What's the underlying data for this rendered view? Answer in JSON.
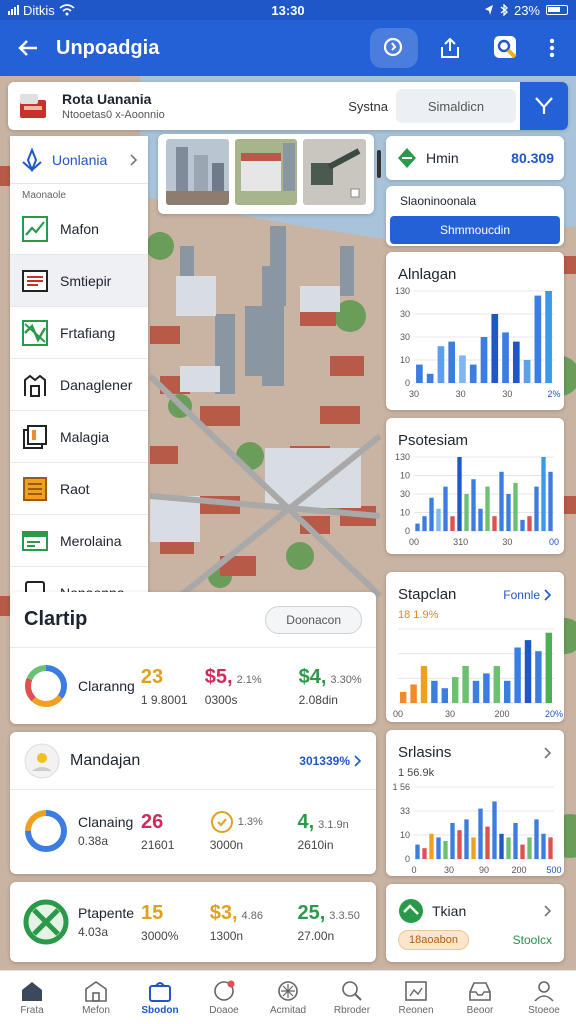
{
  "status_bar": {
    "carrier": "Ditkis",
    "time": "13:30",
    "battery": "23%"
  },
  "app_bar": {
    "title": "Unpoadgia"
  },
  "search": {
    "title": "Rota Uanania",
    "subtitle": "Ntooetas0 x-Aoonnio",
    "label": "Systna",
    "placeholder": "Simaldicn"
  },
  "sidebar": {
    "header": "Uonlania",
    "section": "Maonaole",
    "items": [
      {
        "label": "Mafon",
        "icon": "trend-chart-icon"
      },
      {
        "label": "Smtiepir",
        "icon": "list-document-icon"
      },
      {
        "label": "Frtafiang",
        "icon": "spark-chart-icon"
      },
      {
        "label": "Danaglener",
        "icon": "building-icon"
      },
      {
        "label": "Malagia",
        "icon": "bar-document-icon"
      },
      {
        "label": "Raot",
        "icon": "grid-document-icon"
      },
      {
        "label": "Merolaina",
        "icon": "card-icon"
      },
      {
        "label": "Nonaonna",
        "icon": "phone-icon"
      }
    ]
  },
  "right_panel": {
    "top": {
      "label": "Hmin",
      "value": "80.309"
    },
    "action": {
      "title": "Slaoninoonala",
      "button": "Shmmoucdin"
    },
    "chart1": {
      "title": "Alnlagan"
    },
    "chart2": {
      "title": "Psotesiam"
    },
    "chart3": {
      "title": "Stapclan",
      "link": "Fonnle",
      "subtitle": "18 1.9%"
    },
    "chart4": {
      "title": "Srlasins",
      "subtitle": "1 56.9k"
    },
    "bottom": {
      "label": "Tkian",
      "badge": "18aoabon",
      "link": "Stoolcx"
    }
  },
  "cards": {
    "overview": {
      "title": "Clartip",
      "button": "Doonacon",
      "label": "Claranng",
      "m1": {
        "value": "23",
        "sub": "1 9.8001"
      },
      "m2": {
        "value": "$5,",
        "delta": "2.1%",
        "sub": "0300s"
      },
      "m3": {
        "value": "$4,",
        "delta": "3.30%",
        "sub": "2.08din"
      }
    },
    "manage": {
      "title": "Mandajan",
      "link": "301339%",
      "label": "Clanaing",
      "label_sub": "0.38a",
      "m1": {
        "value": "26",
        "sub": "21601"
      },
      "m2": {
        "value": "",
        "delta": "1.3%",
        "sub": "3000n"
      },
      "m3": {
        "value": "4,",
        "delta": "3.1.9n",
        "sub": "2610in"
      }
    },
    "progress": {
      "label": "Ptapente",
      "label_sub": "4.03a",
      "m1": {
        "value": "15",
        "sub": "3000%"
      },
      "m2": {
        "value": "$3,",
        "delta": "4.86",
        "sub": "1300n"
      },
      "m3": {
        "value": "25,",
        "delta": "3.3.50",
        "sub": "27.00n"
      }
    }
  },
  "chart_data": [
    {
      "type": "bar",
      "title": "Alnlagan",
      "yticks": [
        "130",
        "30",
        "30",
        "10",
        "0"
      ],
      "xticks": [
        "30",
        "30",
        "30",
        "2%"
      ],
      "values": [
        0.2,
        0.1,
        0.4,
        0.45,
        0.3,
        0.2,
        0.5,
        0.75,
        0.55,
        0.45,
        0.25,
        0.95,
        1.0
      ],
      "colors": [
        "#3b7de0",
        "#3b7de0",
        "#5aa0ee",
        "#3b7de0",
        "#7fb7f0",
        "#3b7de0",
        "#3b7de0",
        "#1f56c8",
        "#3b7de0",
        "#1f56c8",
        "#5aa0ee",
        "#3b7de0",
        "#3b9ae8"
      ],
      "ylim": [
        0,
        1
      ]
    },
    {
      "type": "bar",
      "title": "Psotesiam",
      "yticks": [
        "130",
        "10",
        "30",
        "10",
        "0"
      ],
      "xticks": [
        "00",
        "310",
        "30",
        "00"
      ],
      "values": [
        0.1,
        0.2,
        0.45,
        0.3,
        0.6,
        0.2,
        1.0,
        0.5,
        0.7,
        0.3,
        0.6,
        0.2,
        0.8,
        0.5,
        0.65,
        0.15,
        0.2,
        0.6,
        1.0,
        0.8
      ],
      "colors": [
        "#3b7de0",
        "#3b7de0",
        "#3b7de0",
        "#7fb7f0",
        "#3b7de0",
        "#e05050",
        "#1f56c8",
        "#6cc070",
        "#3b7de0",
        "#3b7de0",
        "#6cc070",
        "#e05050",
        "#3b7de0",
        "#3b7de0",
        "#6cc070",
        "#3b7de0",
        "#e05050",
        "#3b7de0",
        "#3b9ae8",
        "#3b7de0"
      ],
      "ylim": [
        0,
        1
      ]
    },
    {
      "type": "bar",
      "title": "Stapclan",
      "xticks": [
        "00",
        "30",
        "200",
        "20%"
      ],
      "values": [
        0.15,
        0.25,
        0.5,
        0.3,
        0.2,
        0.35,
        0.5,
        0.3,
        0.4,
        0.5,
        0.3,
        0.75,
        0.85,
        0.7,
        0.95
      ],
      "colors": [
        "#f08a2a",
        "#f08a2a",
        "#f0a020",
        "#3b7de0",
        "#3b7de0",
        "#6cc070",
        "#6cc070",
        "#3b7de0",
        "#3b7de0",
        "#6cc070",
        "#3b7de0",
        "#3b7de0",
        "#1f56c8",
        "#3b7de0",
        "#4cb050"
      ],
      "ylim": [
        0,
        1
      ]
    },
    {
      "type": "bar",
      "title": "Srlasins",
      "yticks": [
        "1 56",
        "33",
        "10",
        "0"
      ],
      "xticks": [
        "0",
        "30",
        "90",
        "200",
        "500"
      ],
      "values": [
        0.2,
        0.15,
        0.35,
        0.3,
        0.25,
        0.5,
        0.4,
        0.55,
        0.3,
        0.7,
        0.45,
        0.8,
        0.35,
        0.3,
        0.5,
        0.2,
        0.3,
        0.55,
        0.35,
        0.3
      ],
      "colors": [
        "#3b7de0",
        "#e05050",
        "#f0a020",
        "#3b7de0",
        "#6cc070",
        "#3b7de0",
        "#e05050",
        "#3b7de0",
        "#f0a020",
        "#3b7de0",
        "#e05050",
        "#3b7de0",
        "#1f56c8",
        "#6cc070",
        "#3b7de0",
        "#e05050",
        "#6cc070",
        "#3b7de0",
        "#3b7de0",
        "#e05050"
      ],
      "ylim": [
        0,
        1
      ]
    }
  ],
  "bottom_nav": [
    {
      "label": "Frata",
      "icon": "home-icon",
      "active": false
    },
    {
      "label": "Mefon",
      "icon": "store-icon",
      "active": false
    },
    {
      "label": "Sbodon",
      "icon": "bag-icon",
      "active": true
    },
    {
      "label": "Doaoe",
      "icon": "chat-icon",
      "active": false
    },
    {
      "label": "Acmitad",
      "icon": "sparkle-icon",
      "active": false
    },
    {
      "label": "Rbroder",
      "icon": "search-icon",
      "active": false
    },
    {
      "label": "Reonen",
      "icon": "image-icon",
      "active": false
    },
    {
      "label": "Beoor",
      "icon": "inbox-icon",
      "active": false
    },
    {
      "label": "Stoeoe",
      "icon": "user-icon",
      "active": false
    }
  ]
}
